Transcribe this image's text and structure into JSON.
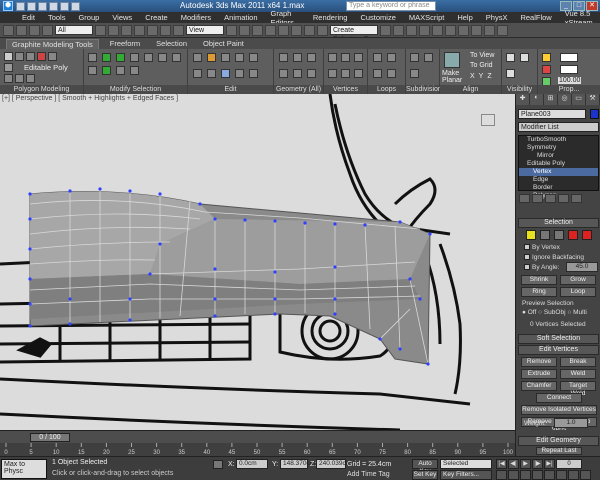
{
  "titlebar": {
    "title": "Autodesk 3ds Max  2011 x64       1.max",
    "search_placeholder": "Type a keyword or phrase"
  },
  "menubar": {
    "items": [
      "Edit",
      "Tools",
      "Group",
      "Views",
      "Create",
      "Modifiers",
      "Animation",
      "Graph Editors",
      "Rendering",
      "Customize",
      "MAXScript",
      "Help",
      "PhysX",
      "RealFlow",
      "Vue 8.5 xStream"
    ]
  },
  "toolbar": {
    "selection_filter": "All",
    "ref_coord": "View",
    "named_set": "Create Selection Se"
  },
  "ribbon": {
    "tabs": [
      "Graphite Modeling Tools",
      "Freeform",
      "Selection",
      "Object Paint"
    ],
    "active_tab": "Graphite Modeling Tools",
    "editable_label": "Editable Poly",
    "panels": [
      "Polygon Modeling",
      "Modify Selection",
      "Edit",
      "Geometry (All)",
      "Vertices",
      "Loops",
      "Subdivision",
      "Align",
      "Visibility",
      "Prop..."
    ],
    "make_planar": "Make Planar",
    "align_view": "To View",
    "align_grid": "To Grid",
    "axes": [
      "X",
      "Y",
      "Z"
    ],
    "percent": "100.00"
  },
  "viewport": {
    "label": "[+] [ Perspective ] [ Smooth + Highlights + Edged Faces ]"
  },
  "command_panel": {
    "object_name": "Plane003",
    "object_color": "#1b33c9",
    "modifier_list": "Modifier List",
    "stack": [
      "TurboSmooth",
      "Symmetry",
      "Mirror",
      "Editable Poly",
      "Vertex",
      "Edge",
      "Border",
      "Polygon"
    ],
    "selection_header": "Selection",
    "by_vertex": "By Vertex",
    "ignore_backfacing": "Ignore Backfacing",
    "by_angle": "By Angle:",
    "by_angle_value": "45.0",
    "shrink": "Shrink",
    "grow": "Grow",
    "ring": "Ring",
    "loop": "Loop",
    "preview_selection": "Preview Selection",
    "preview_options": [
      "Off",
      "SubObj",
      "Multi"
    ],
    "vertices_selected": "0 Vertices Selected",
    "soft_selection": "Soft Selection",
    "edit_vertices": "Edit Vertices",
    "remove": "Remove",
    "break": "Break",
    "extrude": "Extrude",
    "weld": "Weld",
    "chamfer": "Chamfer",
    "target_weld": "Target Weld",
    "connect": "Connect",
    "remove_isolated": "Remove Isolated Vertices",
    "remove_unused": "Remove Unused Map Verts",
    "weight_label": "Weight:",
    "weight_value": "1.0",
    "edit_geometry": "Edit Geometry",
    "repeat_last": "Repeat Last"
  },
  "timeline": {
    "frame": "0 / 100",
    "ticks": [
      "0",
      "5",
      "10",
      "15",
      "20",
      "25",
      "30",
      "35",
      "40",
      "45",
      "50",
      "55",
      "60",
      "65",
      "70",
      "75",
      "80",
      "85",
      "90",
      "95",
      "100"
    ]
  },
  "statusbar": {
    "maxscript": "Max to Physc",
    "status": "1 Object Selected",
    "prompt": "Click or click-and-drag to select objects",
    "x_label": "X:",
    "x_value": "0.0cm",
    "y_label": "Y:",
    "y_value": "148.370cm",
    "z_label": "Z:",
    "z_value": "240.039cm",
    "grid": "Grid = 25.4cm",
    "add_time_tag": "Add Time Tag",
    "auto_key": "Auto Key",
    "set_key": "Set Key",
    "key_selected": "Selected",
    "key_filters": "Key Filters...",
    "frame_field": "0"
  }
}
